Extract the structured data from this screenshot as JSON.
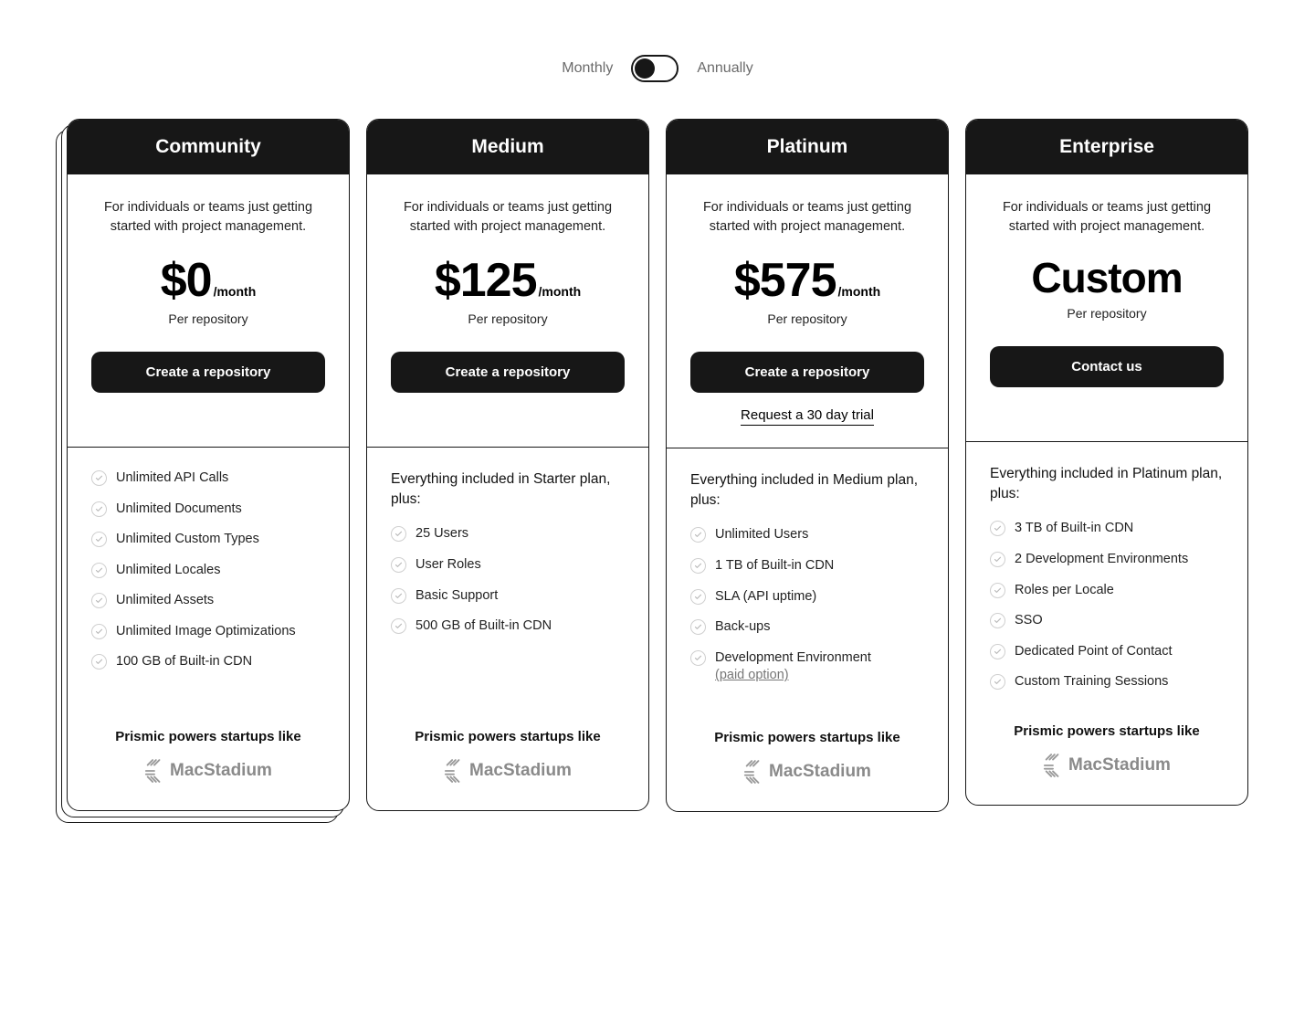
{
  "toggle": {
    "left_label": "Monthly",
    "right_label": "Annually",
    "state": "monthly"
  },
  "common": {
    "subtitle": "For individuals or teams just getting started with project management.",
    "per_month": "/month",
    "per_repo": "Per repository",
    "cta_create": "Create a repository",
    "cta_contact": "Contact us",
    "trial_link": "Request a 30 day trial",
    "powered": "Prismic powers startups like",
    "logo_text_bold": "Mac",
    "logo_text_light": "Stadium",
    "paid_option": "(paid option)"
  },
  "plans": [
    {
      "name": "Community",
      "price": "$0",
      "stacked": true,
      "cta": "create",
      "features_intro": "",
      "features": [
        "Unlimited API Calls",
        "Unlimited Documents",
        "Unlimited Custom Types",
        "Unlimited Locales",
        "Unlimited Assets",
        "Unlimited Image Optimizations",
        "100 GB of Built-in CDN"
      ]
    },
    {
      "name": "Medium",
      "price": "$125",
      "stacked": false,
      "cta": "create",
      "features_intro": "Everything included in Starter plan, plus:",
      "features": [
        "25 Users",
        "User Roles",
        "Basic Support",
        "500 GB of Built-in CDN"
      ]
    },
    {
      "name": "Platinum",
      "price": "$575",
      "stacked": false,
      "cta": "create",
      "has_trial": true,
      "features_intro": "Everything included in Medium plan, plus:",
      "features": [
        "Unlimited Users",
        "1 TB of Built-in CDN",
        "SLA (API uptime)",
        "Back-ups",
        "Development Environment"
      ],
      "paid_option_on": 4
    },
    {
      "name": "Enterprise",
      "price": "Custom",
      "custom_price": true,
      "stacked": false,
      "cta": "contact",
      "features_intro": "Everything included in Platinum plan, plus:",
      "features": [
        "3 TB of Built-in CDN",
        "2 Development Environments",
        "Roles per Locale",
        "SSO",
        "Dedicated Point of Contact",
        "Custom Training Sessions"
      ]
    }
  ]
}
